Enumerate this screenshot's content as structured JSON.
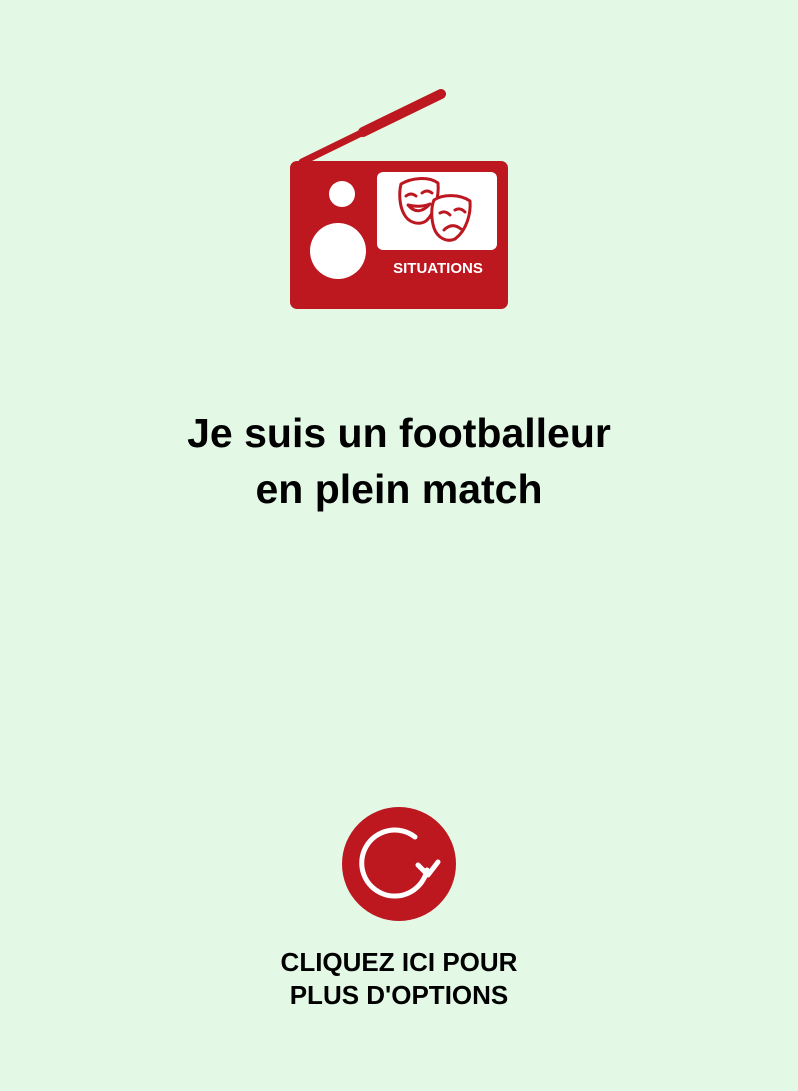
{
  "logo": {
    "label": "SITUATIONS",
    "icon": "radio-theater-masks-icon",
    "color": "#bd1720"
  },
  "situation": {
    "line1": "Je suis un footballeur",
    "line2": "en plein match"
  },
  "refresh": {
    "icon": "refresh-icon",
    "color": "#bd1720"
  },
  "options": {
    "line1": "CLIQUEZ ICI POUR",
    "line2": "PLUS D'OPTIONS"
  },
  "background": "#e3f9e6"
}
